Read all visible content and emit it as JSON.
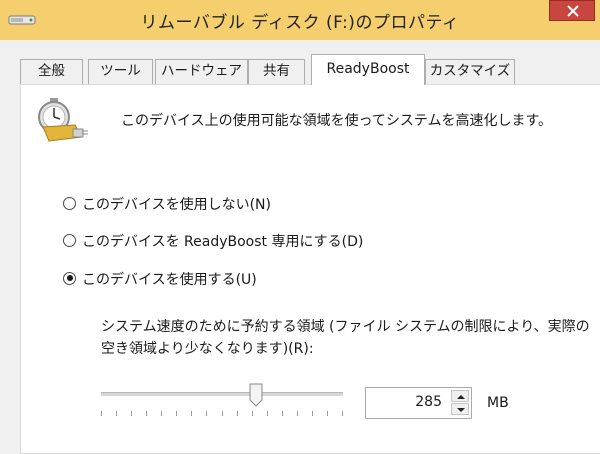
{
  "window": {
    "title": "リムーバブル ディスク (F:)のプロパティ",
    "drive_icon": "removable-drive-icon",
    "close_icon": "close-icon"
  },
  "tabs": [
    {
      "label": "全般",
      "active": false
    },
    {
      "label": "ツール",
      "active": false
    },
    {
      "label": "ハードウェア",
      "active": false
    },
    {
      "label": "共有",
      "active": false
    },
    {
      "label": "ReadyBoost",
      "active": true
    },
    {
      "label": "カスタマイズ",
      "active": false
    }
  ],
  "readyboost": {
    "icon": "readyboost-stopwatch-icon",
    "description": "このデバイス上の使用可能な領域を使ってシステムを高速化します。",
    "options": [
      {
        "label": "このデバイスを使用しない(N)",
        "selected": false
      },
      {
        "label": "このデバイスを ReadyBoost 専用にする(D)",
        "selected": false
      },
      {
        "label": "このデバイスを使用する(U)",
        "selected": true
      }
    ],
    "reserve_label": "システム速度のために予約する領域 (ファイル システムの制限により、実際の空き領域より少なくなります)(R):",
    "slider_fraction": 0.64,
    "reserve_value": "285",
    "unit": "MB"
  },
  "colors": {
    "titlebar": "#f5cf6e",
    "close_button": "#c7463f"
  }
}
